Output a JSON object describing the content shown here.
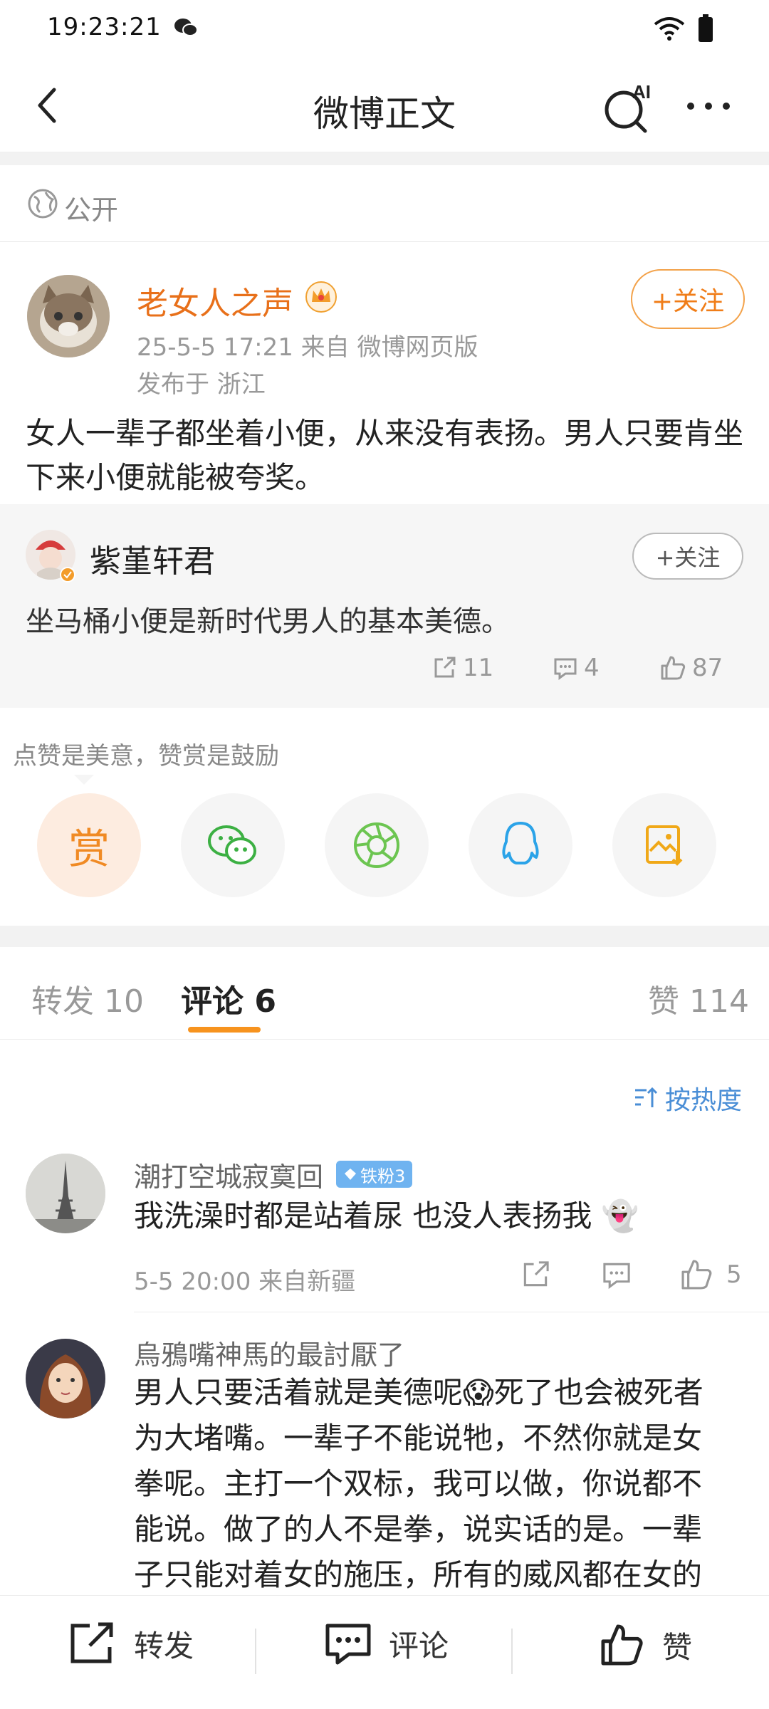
{
  "status_bar": {
    "time": "19:23:21"
  },
  "nav": {
    "title": "微博正文",
    "ai_label": "AI"
  },
  "visibility": {
    "label": "公开"
  },
  "post": {
    "author": "老女人之声",
    "meta": "25-5-5 17:21  来自 微博网页版",
    "location": "发布于 浙江",
    "follow_label": "+关注",
    "text": "女人一辈子都坐着小便，从来没有表扬。男人只要肯坐下来小便就能被夸奖。"
  },
  "repost": {
    "author": "紫堇轩君",
    "follow_label": "+关注",
    "text": "坐马桶小便是新时代男人的基本美德。",
    "reposts": "11",
    "comments": "4",
    "likes": "87"
  },
  "reward": {
    "tip": "点赞是美意，赞赏是鼓励",
    "button_label": "赏"
  },
  "tabs": {
    "repost": "转发 10",
    "comment": "评论 6",
    "like": "赞 114"
  },
  "sort": {
    "label": "按热度"
  },
  "comments": [
    {
      "author": "潮打空城寂寞回",
      "badge": "铁粉3",
      "text": "我洗澡时都是站着尿 也没人表扬我 👻",
      "meta": "5-5 20:00  来自新疆",
      "likes": "5"
    },
    {
      "author": "烏鴉嘴神馬的最討厭了",
      "text_lines": [
        "男人只要活着就是美德呢😱死了也会被死者",
        "为大堵嘴。一辈子不能说牠，不然你就是女",
        "拳呢。主打一个双标，我可以做，你说都不",
        "能说。做了的人不是拳，说实话的是。一辈",
        "子只能对着女的施压，所有的威风都在女的"
      ]
    }
  ],
  "bottom_bar": {
    "repost": "转发",
    "comment": "评论",
    "like": "赞"
  },
  "colors": {
    "accent": "#f07d18",
    "link_blue": "#4a8ed6",
    "tab_underline": "#f7931e"
  }
}
